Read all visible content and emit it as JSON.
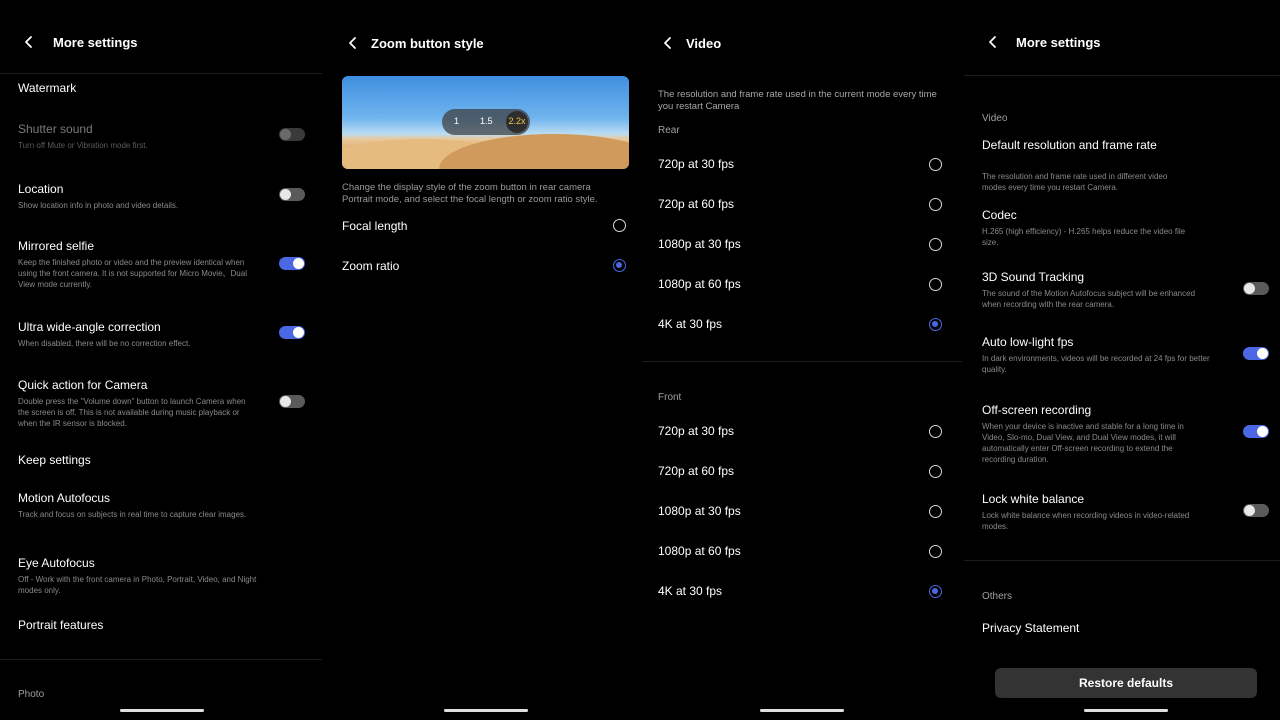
{
  "panel1": {
    "title": "More settings",
    "watermark": "Watermark",
    "shutter_sound": {
      "label": "Shutter sound",
      "desc": "Turn off Mute or Vibration mode first.",
      "on": false
    },
    "location": {
      "label": "Location",
      "desc": "Show location info in photo and video details.",
      "on": false
    },
    "mirrored_selfie": {
      "label": "Mirrored selfie",
      "desc": "Keep the finished photo or video and the preview identical when using the front camera. It is not supported for Micro Movie、Dual View mode currently.",
      "on": true
    },
    "ultra_wide": {
      "label": "Ultra wide-angle correction",
      "desc": "When disabled, there will be no correction effect.",
      "on": true
    },
    "quick_action": {
      "label": "Quick action for Camera",
      "desc": "Double press the \"Volume down\" button to launch Camera when the screen is off. This is not available during music playback or when the IR sensor is blocked.",
      "on": false
    },
    "keep_settings": "Keep settings",
    "motion_af": {
      "label": "Motion Autofocus",
      "desc": "Track and focus on subjects in real time to capture clear images."
    },
    "eye_af": {
      "label": "Eye Autofocus",
      "desc": "Off - Work with the front camera in Photo, Portrait, Video, and Night modes only."
    },
    "portrait": "Portrait features",
    "photo_section": "Photo"
  },
  "panel2": {
    "title": "Zoom button style",
    "zoom_values": [
      "1",
      "1.5",
      "2.2x"
    ],
    "desc": "Change the display style of the zoom button in rear camera Portrait mode, and select the focal length or zoom ratio style.",
    "options": [
      "Focal length",
      "Zoom ratio"
    ],
    "selected": 1
  },
  "panel3": {
    "title": "Video",
    "desc": "The resolution and frame rate used in the current mode every time you restart Camera",
    "rear_label": "Rear",
    "rear_options": [
      "720p at 30 fps",
      "720p at 60 fps",
      "1080p at 30 fps",
      "1080p at 60 fps",
      "4K at 30 fps"
    ],
    "rear_selected": 4,
    "front_label": "Front",
    "front_options": [
      "720p at 30 fps",
      "720p at 60 fps",
      "1080p at 30 fps",
      "1080p at 60 fps",
      "4K at 30 fps"
    ],
    "front_selected": 4
  },
  "panel4": {
    "title": "More settings",
    "video_section": "Video",
    "default_res": {
      "label": "Default resolution and frame rate",
      "desc": "The resolution and frame rate used in different video modes every time you restart Camera."
    },
    "codec": {
      "label": "Codec",
      "desc": "H.265 (high efficiency) - H.265 helps reduce the video file size."
    },
    "sound_tracking": {
      "label": "3D Sound Tracking",
      "desc": "The sound of the Motion Autofocus subject will be enhanced when recording with the rear camera.",
      "on": false
    },
    "low_light": {
      "label": "Auto low-light fps",
      "desc": "In dark environments, videos will be recorded at 24 fps for better quality.",
      "on": true
    },
    "offscreen": {
      "label": "Off-screen recording",
      "desc": "When your device is inactive and stable for a long time in Video, Slo-mo, Dual View, and Dual View modes, it will automatically enter Off-screen recording to extend the recording duration.",
      "on": true
    },
    "lock_wb": {
      "label": "Lock white balance",
      "desc": "Lock white balance when recording videos in video-related modes.",
      "on": false
    },
    "others_section": "Others",
    "privacy": "Privacy Statement",
    "restore": "Restore defaults"
  },
  "colors": {
    "accent": "#4b67e3",
    "background": "#000000",
    "toggle_off": "#5a5a5a"
  },
  "icons": {
    "back": "chevron-left-icon"
  }
}
